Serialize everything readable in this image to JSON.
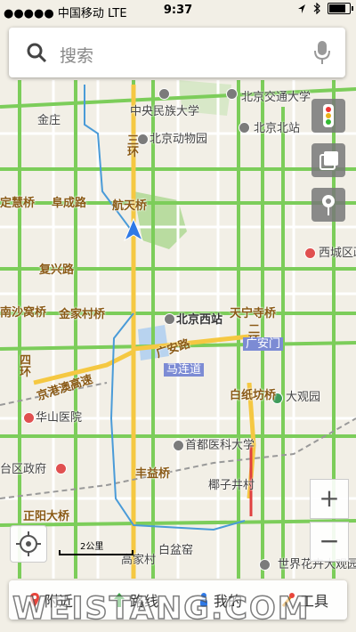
{
  "status_bar": {
    "carrier": "●●●●● 中国移动 LTE",
    "time": "9:37",
    "battery_level": 0.8
  },
  "search": {
    "placeholder": "搜索",
    "search_icon": "search-icon",
    "mic_icon": "microphone-icon"
  },
  "map_labels": {
    "beijing_jiaotong_univ": "北京交通大学",
    "fengtai": "丰台",
    "minzu_univ": "中央民族大学",
    "jinzhuang": "金庄",
    "beijing_zoo": "北京动物园",
    "beijing_north_station": "北京北站",
    "sanhuan": "三环",
    "dinghuiqiao": "定慧桥",
    "fuchenglu": "阜成路",
    "hangtianqiao": "航天桥",
    "xicheng_gov": "西城区政",
    "fuxinglu": "复兴路",
    "shawoqiao": "南沙窝桥",
    "jinjiacunqiao": "金家村桥",
    "beijing_west": "北京西站",
    "tianningsiqiao": "天宁寺桥",
    "erhuan": "二环",
    "guanganmen_road": "广安路",
    "guanganmen": "广安门",
    "malian_dao": "马连道",
    "sihuan": "四环",
    "jinggang_ao": "京港澳高速",
    "baizhifangqiao": "白纸坊桥",
    "huashan_hospital": "华山医院",
    "daguanyuan": "大观园",
    "capital_medical": "首都医科大学",
    "district_gov": "台区政府",
    "fengyiqiao": "丰益桥",
    "liuzijing": "椰子井村",
    "zhengyangdaqiao": "正阳大桥",
    "baipenyao": "白盆窑",
    "hanzhuang": "高家村",
    "world_park": "世界花卉大观园"
  },
  "scale": {
    "label": "2公里"
  },
  "zoom": {
    "in": "+",
    "out": "−"
  },
  "tabs": [
    {
      "label": "附近",
      "icon": "location-pin-icon"
    },
    {
      "label": "路线",
      "icon": "route-arrow-icon"
    },
    {
      "label": "我的",
      "icon": "person-icon"
    },
    {
      "label": "工具",
      "icon": "tools-icon"
    }
  ],
  "watermark": "WEISTANG.COM",
  "colors": {
    "road_major": "#7ccd5a",
    "road_minor": "#ffffff",
    "route_blue": "#4a9bd8",
    "arrow_blue": "#2f79e6"
  }
}
